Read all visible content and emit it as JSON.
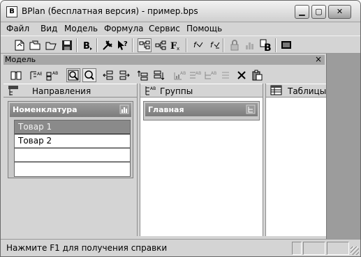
{
  "window": {
    "title": "BPlan (бесплатная версия) - пример.bps",
    "app_icon": "B"
  },
  "window_controls": {
    "minimize": "▁",
    "maximize": "▢",
    "close": "✕"
  },
  "menu": {
    "items": [
      "Файл",
      "Вид",
      "Модель",
      "Формула",
      "Сервис",
      "Помощь"
    ]
  },
  "toolbar": {
    "icons": [
      "new-icon",
      "open-folder-icon",
      "open-icon",
      "save-icon",
      "bold-b-icon",
      "tools-icon",
      "help-cursor-icon",
      "tree-icon",
      "structure-icon",
      "formula-icon",
      "calc-icon",
      "calc-all-icon",
      "lock-icon",
      "chart-icon",
      "report-b-icon",
      "display-icon"
    ]
  },
  "model_panel": {
    "title": "Модель",
    "close": "×",
    "columns": {
      "directions": {
        "label": "Направления"
      },
      "groups": {
        "label": "Группы"
      },
      "tables": {
        "label": "Таблицы"
      }
    }
  },
  "nomenclature_card": {
    "title": "Номенклатура",
    "items": [
      {
        "label": "Товар 1",
        "selected": true
      },
      {
        "label": "Товар 2",
        "selected": false
      }
    ]
  },
  "group_card": {
    "title": "Главная"
  },
  "status": {
    "text": "Нажмите F1 для получения справки"
  }
}
